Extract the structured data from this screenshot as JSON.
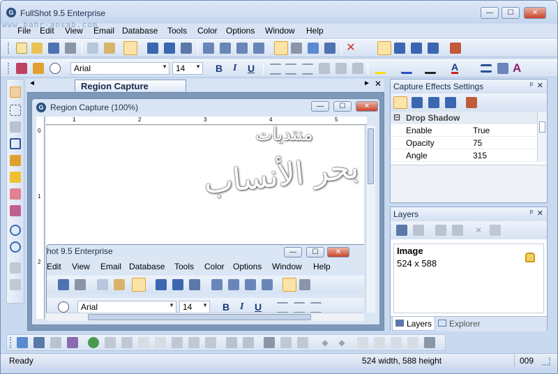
{
  "app": {
    "title": "FullShot 9.5 Enterprise",
    "watermark": "www.bahr-ansab.com"
  },
  "window_controls": {
    "minimize": "—",
    "maximize": "☐",
    "close": "✕"
  },
  "menu": [
    "File",
    "Edit",
    "View",
    "Email",
    "Database",
    "Tools",
    "Color",
    "Options",
    "Window",
    "Help"
  ],
  "format": {
    "font": "Arial",
    "size": "14",
    "bold": "B",
    "italic": "I",
    "underline": "U",
    "color_a": "A"
  },
  "doc": {
    "tab_label": "Region Capture (100%)",
    "window_title": "Region Capture (100%)",
    "ruler_h": [
      "1",
      "2",
      "3",
      "4",
      "5"
    ],
    "ruler_v": [
      "0",
      "1",
      "2"
    ],
    "nav_prev": "◄",
    "nav_next": "►",
    "close": "✕"
  },
  "captured": {
    "title": "hot 9.5 Enterprise",
    "menu": [
      "Edit",
      "View",
      "Email",
      "Database",
      "Tools",
      "Color",
      "Options",
      "Window",
      "Help"
    ],
    "font": "Arial",
    "size": "14",
    "bold": "B",
    "italic": "I",
    "underline": "U",
    "arabic_top": "منتديات",
    "arabic_main": "بحر الأنساب"
  },
  "effects": {
    "title": "Capture Effects Settings",
    "pin": "ᵖ",
    "close": "✕",
    "group": "Drop Shadow",
    "rows": [
      {
        "name": "Enable",
        "value": "True"
      },
      {
        "name": "Opacity",
        "value": "75"
      },
      {
        "name": "Angle",
        "value": "315"
      }
    ]
  },
  "layers": {
    "title": "Layers",
    "pin": "ᵖ",
    "close": "✕",
    "item_name": "Image",
    "item_size": "524 x 588",
    "tab_layers": "Layers",
    "tab_explorer": "Explorer"
  },
  "status": {
    "text": "Ready",
    "dimensions": "524 width, 588 height",
    "counter": "009"
  },
  "colors": {
    "accent": "#2a4f80",
    "title_bg": "#c4d6ef",
    "close": "#c8452b"
  }
}
